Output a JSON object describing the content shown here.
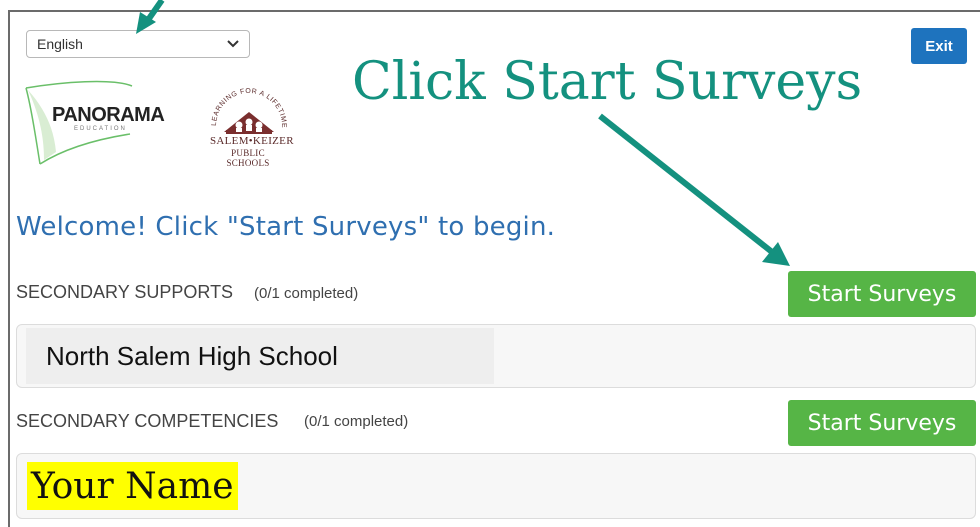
{
  "language_select": {
    "value": "English"
  },
  "exit_label": "Exit",
  "annotation": {
    "text": "Click Start Surveys"
  },
  "logos": {
    "panorama_word": "PANORAMA",
    "panorama_sub": "EDUCATION",
    "sk_arc": "LEARNING FOR A LIFETIME",
    "sk_line1": "SALEM•KEIZER",
    "sk_line2": "PUBLIC SCHOOLS"
  },
  "welcome": "Welcome! Click \"Start Surveys\" to begin.",
  "sections": [
    {
      "title": "SECONDARY SUPPORTS",
      "count": "(0/1 completed)",
      "button": "Start Surveys",
      "card": "North Salem High School"
    },
    {
      "title": "SECONDARY COMPETENCIES",
      "count": "(0/1 completed)",
      "button": "Start Surveys",
      "card": "Your Name"
    }
  ],
  "colors": {
    "annotation": "#14917f",
    "start_button": "#56b546",
    "exit_button": "#1e73be",
    "welcome_text": "#2f6fb0",
    "highlight": "#ffff00"
  }
}
